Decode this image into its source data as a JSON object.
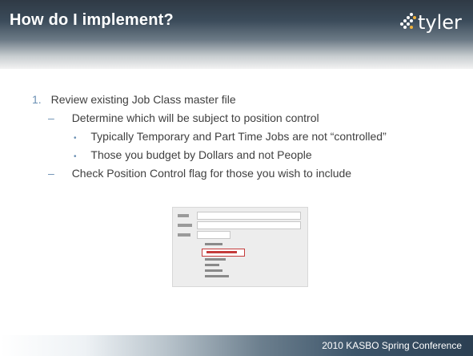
{
  "header": {
    "title": "How do I implement?",
    "logo_text": "tyler"
  },
  "content": {
    "step1_number": "1.",
    "step1_text": "Review existing Job Class master file",
    "sub1_dash": "–",
    "sub1_text": "Determine which will be subject to position control",
    "bullet1_text": "Typically Temporary and Part Time Jobs are not “controlled”",
    "bullet2_text": "Those you budget by Dollars and not People",
    "sub2_dash": "–",
    "sub2_text": "Check Position Control flag for those you wish to include",
    "bullet_glyph": "•"
  },
  "footer": {
    "text": "2010 KASBO Spring Conference"
  },
  "colors": {
    "header_dark": "#2f3a45",
    "accent": "#6a8fb3",
    "body_text": "#404040",
    "highlight": "#c43b3b"
  },
  "icons": [
    "tyler-logo-icon"
  ]
}
